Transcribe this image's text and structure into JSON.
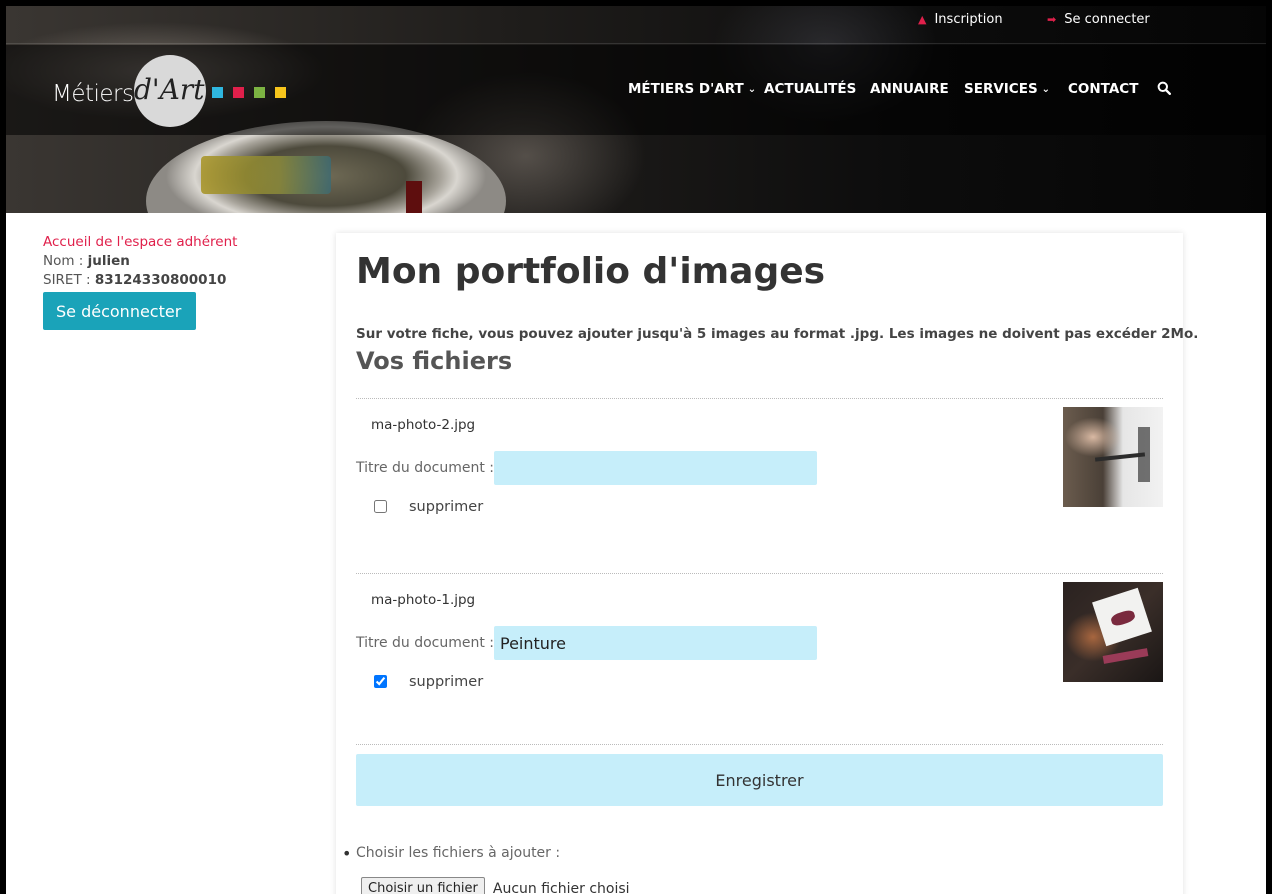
{
  "topbar": {
    "register_label": "Inscription",
    "login_label": "Se connecter"
  },
  "logo": {
    "text_metiers": "Métiers",
    "text_dart": "d'Art",
    "squares": [
      "#2fb7e0",
      "#e0204b",
      "#7cb342",
      "#f7c51c"
    ]
  },
  "nav": {
    "items": [
      {
        "label": "MÉTIERS D'ART",
        "dropdown": true
      },
      {
        "label": "ACTUALITÉS",
        "dropdown": false
      },
      {
        "label": "ANNUAIRE",
        "dropdown": false
      },
      {
        "label": "SERVICES",
        "dropdown": true
      },
      {
        "label": "CONTACT",
        "dropdown": false
      }
    ],
    "search_icon": "search-icon"
  },
  "sidebar": {
    "home_link": "Accueil de l'espace adhérent",
    "name_label": "Nom :",
    "name_value": "julien",
    "siret_label": "SIRET :",
    "siret_value": "83124330800010",
    "logout_label": "Se déconnecter"
  },
  "main": {
    "title": "Mon portfolio d'images",
    "notice": "Sur votre fiche, vous pouvez ajouter jusqu'à 5 images au format .jpg. Les images ne doivent pas excéder 2Mo.",
    "files_heading": "Vos fichiers",
    "files": [
      {
        "filename": "ma-photo-2.jpg",
        "title_label": "Titre du document :",
        "title_value": "",
        "delete_label": "supprimer",
        "delete_checked": false
      },
      {
        "filename": "ma-photo-1.jpg",
        "title_label": "Titre du document :",
        "title_value": "Peinture",
        "delete_label": "supprimer",
        "delete_checked": true
      }
    ],
    "save_label": "Enregistrer",
    "add_files_label": "Choisir les fichiers à ajouter :",
    "file_button_label": "Choisir un fichier",
    "file_status": "Aucun fichier choisi"
  },
  "colors": {
    "accent_red": "#e0204b",
    "button_teal": "#1aa3b9",
    "input_bg": "#c6eefa"
  }
}
